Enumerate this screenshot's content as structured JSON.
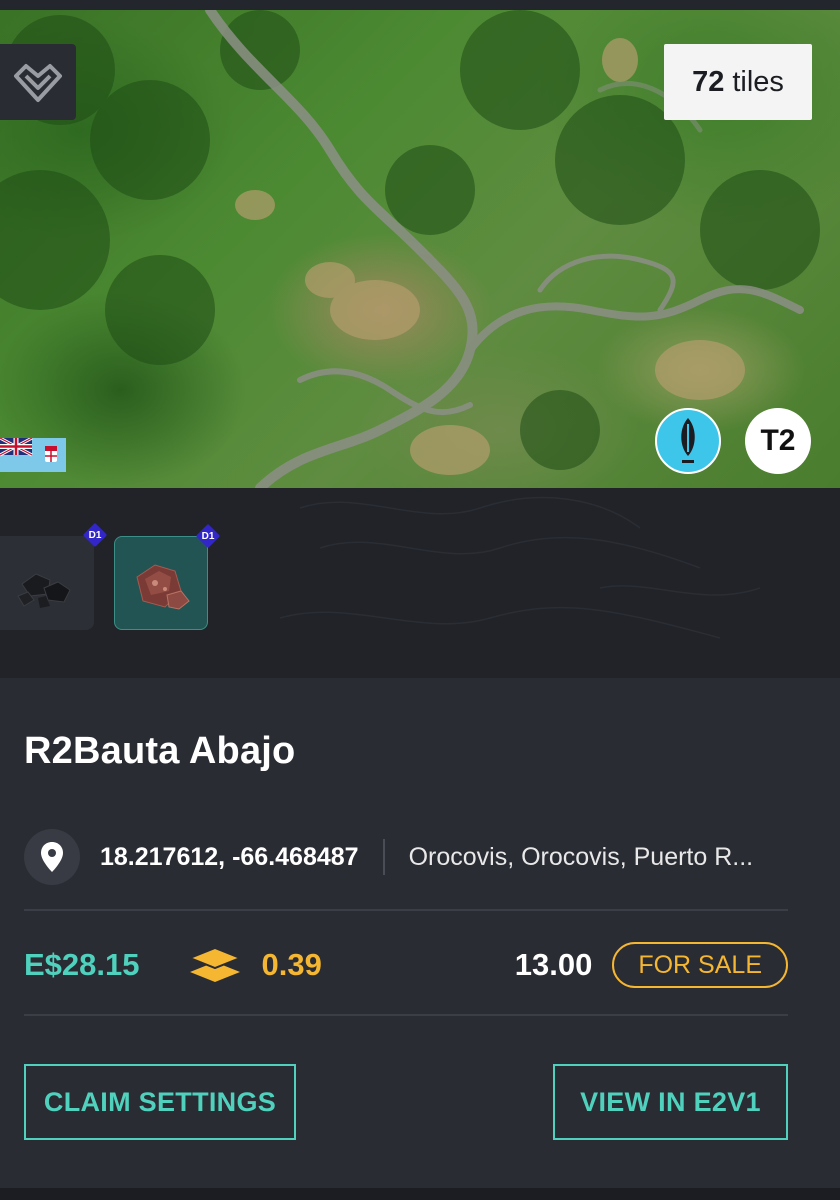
{
  "map": {
    "tiles_count": "72",
    "tiles_unit": "tiles",
    "tier_label": "T2"
  },
  "resources": [
    {
      "name": "coal",
      "tier": "D1"
    },
    {
      "name": "ore",
      "tier": "D1"
    }
  ],
  "property": {
    "title": "R2Bauta Abajo",
    "coordinates": "18.217612, -66.468487",
    "address": "Orocovis, Orocovis, Puerto R...",
    "price": "E$28.15",
    "yield": "0.39",
    "sale_price": "13.00",
    "sale_status": "FOR SALE"
  },
  "actions": {
    "claim_settings": "CLAIM SETTINGS",
    "view_in": "VIEW IN E2V1"
  },
  "colors": {
    "accent_teal": "#4fd1bd",
    "accent_gold": "#f5b632",
    "panel_bg": "#2a2c33",
    "page_bg": "#1b1d22"
  },
  "icons": [
    "logo-icon",
    "flag-icon",
    "surfboard-icon",
    "location-pin-icon",
    "layers-icon",
    "coal-resource-icon",
    "ore-resource-icon"
  ]
}
